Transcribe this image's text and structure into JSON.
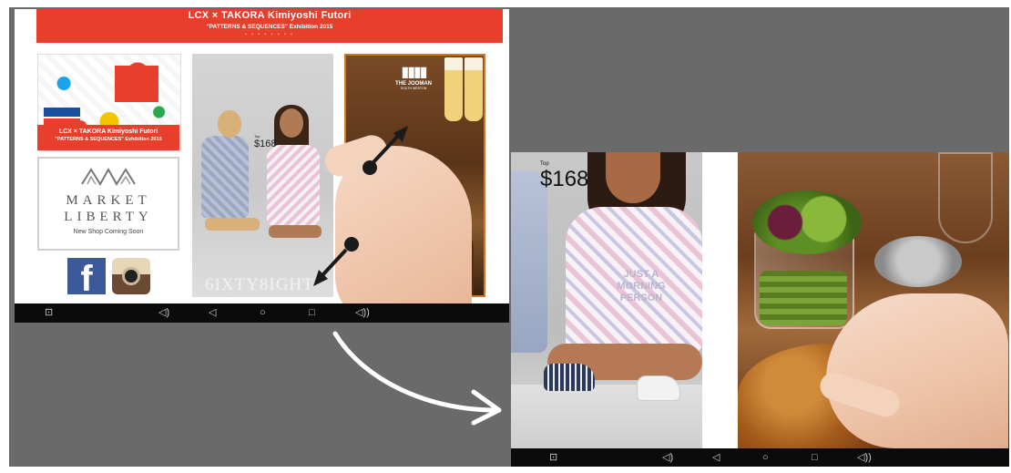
{
  "colors": {
    "background": "#6a6a6a",
    "accent_red": "#e83e2c",
    "nav_bar": "#0b0b0b"
  },
  "left_screen": {
    "banner": {
      "title": "LCX × TAKORA Kimiyoshi Futori",
      "subtitle": "\"PATTERNS & SEQUENCES\" Exhibition 2015",
      "dots": "• • • • • • • •"
    },
    "art_tile": {
      "caption_line1": "LCX × TAKORA Kimiyoshi Futori",
      "caption_line2": "\"PATTERNS & SEQUENCES\" Exhibition 2015"
    },
    "market_tile": {
      "name_line1": "MARKET",
      "name_line2": "LIBERTY",
      "note": "New Shop Coming Soon"
    },
    "social": {
      "facebook_glyph": "f"
    },
    "fashion_tile": {
      "price_label": "Top",
      "price": "$168",
      "brand": "6IXTY8IGHT"
    },
    "food_tile": {
      "logo_bottles": "▮▮▮▮",
      "logo_name": "THE JOOMAN",
      "logo_sub": "SOUTH WESTON"
    },
    "nav": {
      "icons": [
        "screenshot-icon",
        "volume-down-icon",
        "back-icon",
        "home-icon",
        "recents-icon",
        "volume-up-icon"
      ],
      "glyphs": [
        "⊡",
        "◁)",
        "◁",
        "○",
        "□",
        "◁))"
      ]
    }
  },
  "right_screen": {
    "fashion": {
      "price_label": "Top",
      "price": "$168",
      "shirt_text": "JUST A MORNING PERSON"
    },
    "nav": {
      "icons": [
        "screenshot-icon",
        "volume-down-icon",
        "back-icon",
        "home-icon",
        "recents-icon",
        "volume-up-icon"
      ],
      "glyphs": [
        "⊡",
        "◁)",
        "◁",
        "○",
        "□",
        "◁))"
      ]
    }
  }
}
